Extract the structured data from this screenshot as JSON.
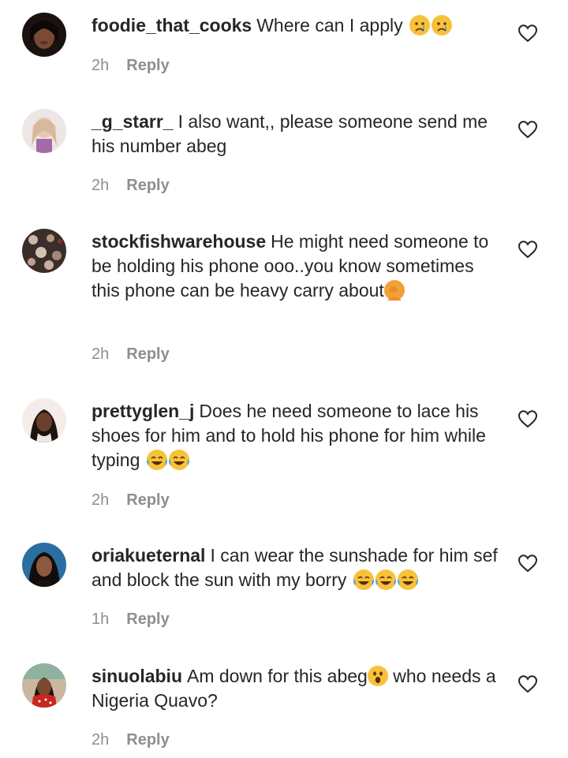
{
  "reply_label": "Reply",
  "comments": [
    {
      "username": "foodie_that_cooks",
      "text": "Where can I apply",
      "emojis": [
        "crying-face",
        "crying-face"
      ],
      "time": "2h"
    },
    {
      "username": "_g_starr_",
      "text": "I also want,, please someone send me his number abeg",
      "emojis": [],
      "time": "2h"
    },
    {
      "username": "stockfishwarehouse",
      "text": "He might need someone to be holding his phone ooo..you know sometimes this phone can be heavy carry about",
      "emojis": [
        "facepalm"
      ],
      "time": "2h"
    },
    {
      "username": "prettyglen_j",
      "text": "Does he need someone to lace his shoes for him and to hold his phone for him while typing",
      "emojis": [
        "tears-of-joy",
        "tears-of-joy"
      ],
      "time": "2h"
    },
    {
      "username": "oriakueternal",
      "text": "I can wear the sunshade for him sef and block the sun with my borry",
      "emojis": [
        "tears-of-joy",
        "tears-of-joy",
        "tears-of-joy"
      ],
      "time": "1h"
    },
    {
      "username": "sinuolabiu",
      "text": "Am down for this abeg",
      "emojis": [
        "astonished-face"
      ],
      "text_after": "who needs a Nigeria Quavo?",
      "time": "2h"
    }
  ],
  "colors": {
    "text": "#262626",
    "meta": "#8e8e8e",
    "emoji_yellow": "#f7c23a"
  }
}
